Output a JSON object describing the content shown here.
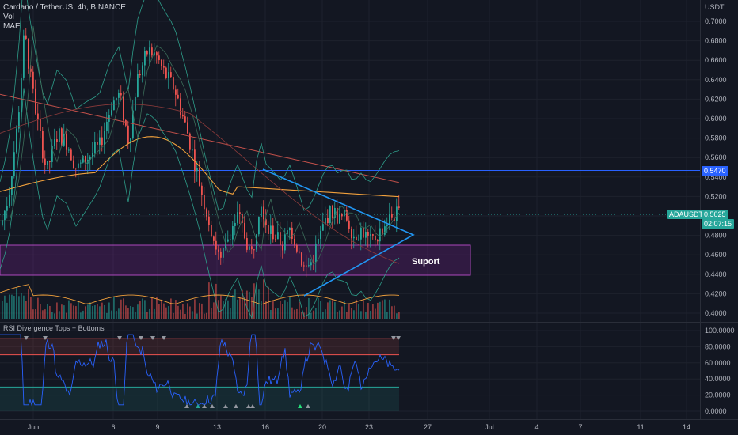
{
  "header": {
    "symbol_line": "Cardano / TetherUS, 4h, BINANCE",
    "indicators": [
      "Vol",
      "MAE"
    ]
  },
  "price_axis": {
    "currency": "USDT",
    "ticks": [
      "0.7000",
      "0.6800",
      "0.6600",
      "0.6400",
      "0.6200",
      "0.6000",
      "0.5800",
      "0.5600",
      "0.5400",
      "0.5200",
      "0.5000",
      "0.4800",
      "0.4600",
      "0.4400",
      "0.4200",
      "0.4000"
    ],
    "min": 0.3975,
    "max": 0.7035
  },
  "rsi_axis": {
    "ticks": [
      "100.0000",
      "80.0000",
      "60.0000",
      "40.0000",
      "20.0000",
      "0.0000"
    ],
    "min": 0,
    "max": 100
  },
  "time_axis": {
    "labels": [
      "Jun",
      "6",
      "9",
      "13",
      "16",
      "20",
      "23",
      "27",
      "Jul",
      "4",
      "7",
      "11",
      "14"
    ]
  },
  "tags": {
    "resistance_value": "0.5470",
    "symbol": "ADAUSDT",
    "last_price": "0.5025",
    "countdown": "02:07:15"
  },
  "annotations": {
    "support_label": "Suport",
    "resistance_level": 0.547,
    "support_zone": [
      0.439,
      0.47
    ],
    "triangle_apex": 0.4825
  },
  "rsi_indicator": {
    "title": "RSI Divergence Tops + Bottoms",
    "upper_band": 90,
    "mid_band": 70,
    "lower_band": 30
  },
  "colors": {
    "background": "#131722",
    "up_candle": "#26a69a",
    "down_candle": "#ef5350",
    "resistance_line": "#2962ff",
    "triangle": "#2196f3",
    "support_zone": "#9c27b0",
    "price_tag": "#26a69a",
    "rsi_line": "#2962ff",
    "moving_avg_orange": "#f0a03c",
    "moving_avg_red": "#c2504a",
    "bollinger": "#2e9e8a"
  }
}
